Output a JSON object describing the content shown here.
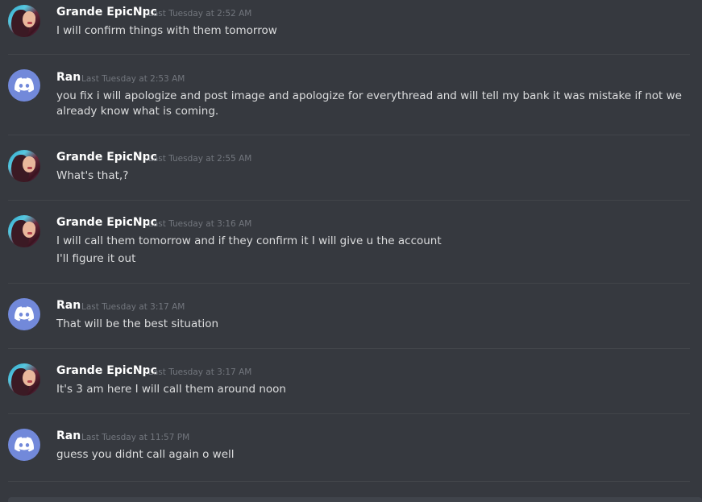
{
  "messages": [
    {
      "author": "Grande EpicNpc",
      "timestamp": "Last Tuesday at 2:52 AM",
      "avatar": "photo-avatar",
      "lines": [
        "I will confirm things with them tomorrow"
      ]
    },
    {
      "author": "Ran",
      "timestamp": "Last Tuesday at 2:53 AM",
      "avatar": "discord-logo-avatar",
      "lines": [
        "you fix i will apologize and post image and apologize for everythread and will tell my bank it was mistake if not we",
        "already know what is coming."
      ]
    },
    {
      "author": "Grande EpicNpc",
      "timestamp": "Last Tuesday at 2:55 AM",
      "avatar": "photo-avatar",
      "lines": [
        "What's that,?"
      ]
    },
    {
      "author": "Grande EpicNpc",
      "timestamp": "Last Tuesday at 3:16 AM",
      "avatar": "photo-avatar",
      "lines": [
        "I will call them tomorrow and if they confirm it I will give u the account",
        "I'll figure it out"
      ]
    },
    {
      "author": "Ran",
      "timestamp": "Last Tuesday at 3:17 AM",
      "avatar": "discord-logo-avatar",
      "lines": [
        "That will be the best situation"
      ]
    },
    {
      "author": "Grande EpicNpc",
      "timestamp": "Last Tuesday at 3:17 AM",
      "avatar": "photo-avatar",
      "lines": [
        "It's 3 am here I will call them around noon"
      ]
    },
    {
      "author": "Ran",
      "timestamp": "Last Tuesday at 11:57 PM",
      "avatar": "discord-logo-avatar",
      "lines": [
        "guess you didnt call again o well"
      ]
    }
  ],
  "colors": {
    "background": "#36393f",
    "author": "#ffffff",
    "timestamp": "#72767d",
    "text": "#dcddde",
    "discord_blurple": "#7289da",
    "separator": "#42454a"
  }
}
